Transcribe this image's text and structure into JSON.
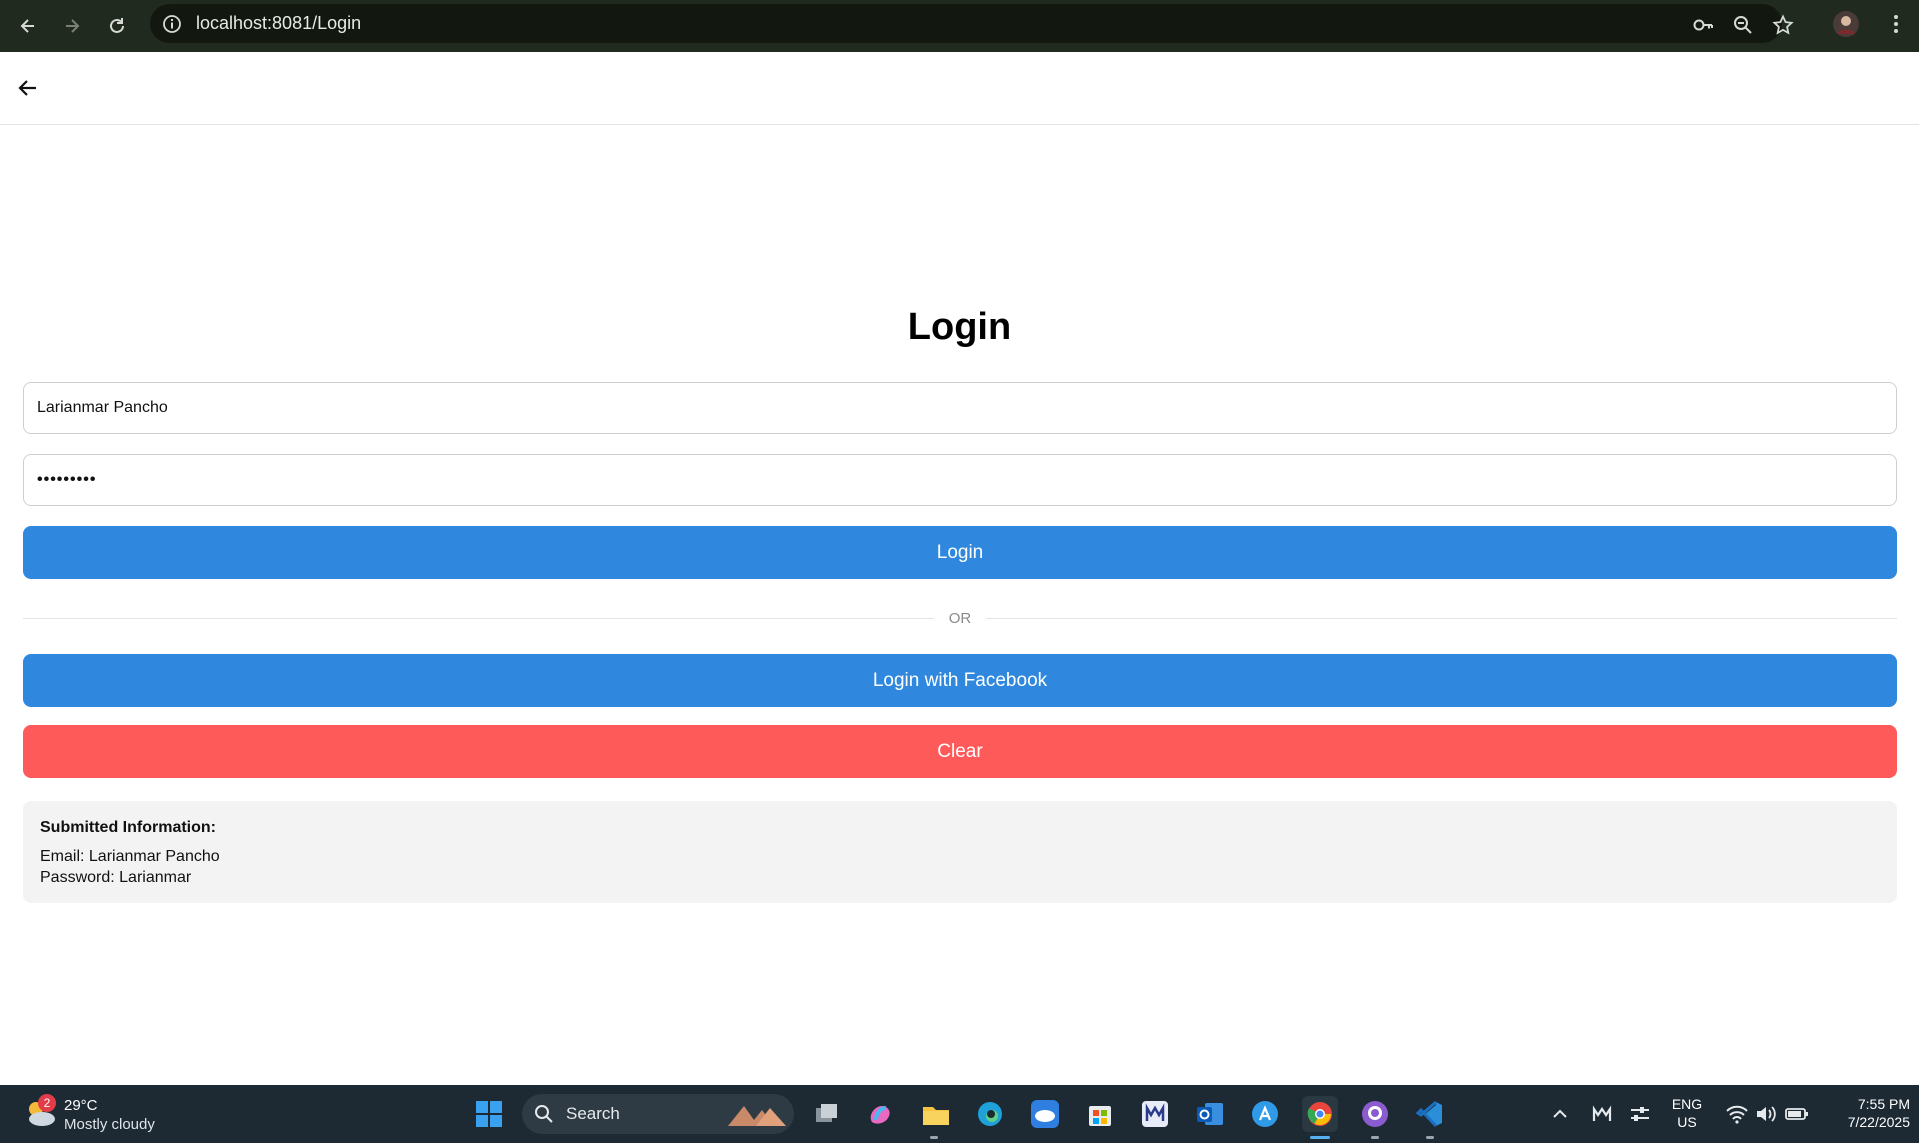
{
  "browser": {
    "url": "localhost:8081/Login"
  },
  "login": {
    "title": "Login",
    "email_value": "Larianmar Pancho",
    "password_value": "•••••••••",
    "login_button": "Login",
    "or_text": "OR",
    "facebook_button": "Login with Facebook",
    "clear_button": "Clear"
  },
  "submitted": {
    "header": "Submitted Information:",
    "email_line": "Email: Larianmar Pancho",
    "password_line": "Password: Larianmar"
  },
  "taskbar": {
    "weather_badge": "2",
    "temperature": "29°C",
    "condition": "Mostly cloudy",
    "search_label": "Search",
    "lang_top": "ENG",
    "lang_bottom": "US",
    "time": "7:55 PM",
    "date": "7/22/2025"
  },
  "colors": {
    "primary": "#2f88de",
    "danger": "#ff5a5a"
  }
}
